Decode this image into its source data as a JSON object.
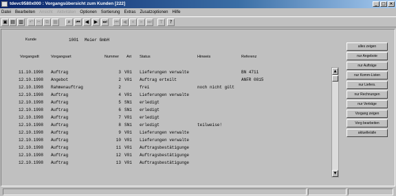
{
  "window": {
    "title": "tdevc9580x000 : Vorgangsübersicht zum Kunden [222]",
    "buttons": [
      "_",
      "□",
      "×"
    ]
  },
  "menu": [
    {
      "label": "Datei",
      "enabled": true
    },
    {
      "label": "Bearbeiten",
      "enabled": true
    },
    {
      "label": "Ansicht",
      "enabled": false
    },
    {
      "label": "Aktivitäten",
      "enabled": false
    },
    {
      "label": "Optionen",
      "enabled": true
    },
    {
      "label": "Sortierung",
      "enabled": true
    },
    {
      "label": "Extras",
      "enabled": true
    },
    {
      "label": "Zusatzoptionen",
      "enabled": true
    },
    {
      "label": "Hilfe",
      "enabled": true
    }
  ],
  "toolbar": [
    {
      "name": "new-icon",
      "glyph": "▣",
      "enabled": true
    },
    {
      "name": "save-icon",
      "glyph": "▤",
      "enabled": true
    },
    {
      "name": "print-icon",
      "glyph": "▥",
      "enabled": true
    },
    {
      "name": "undo-icon",
      "glyph": "↶",
      "enabled": false
    },
    {
      "name": "cut-icon",
      "glyph": "✂",
      "enabled": false
    },
    {
      "name": "copy-icon",
      "glyph": "⧉",
      "enabled": false
    },
    {
      "name": "paste-icon",
      "glyph": "▦",
      "enabled": false
    },
    {
      "name": "find-icon",
      "glyph": "⌕",
      "enabled": true
    },
    {
      "name": "first-record-icon",
      "glyph": "⏮",
      "enabled": true
    },
    {
      "name": "previous-record-icon",
      "glyph": "◀",
      "enabled": true
    },
    {
      "name": "next-record-icon",
      "glyph": "▶",
      "enabled": true
    },
    {
      "name": "last-record-icon",
      "glyph": "⏭",
      "enabled": true
    },
    {
      "name": "first-page-icon",
      "glyph": "⏮",
      "enabled": false
    },
    {
      "name": "previous-page-icon",
      "glyph": "◀",
      "enabled": false
    },
    {
      "name": "rewind-icon",
      "glyph": "«",
      "enabled": false
    },
    {
      "name": "forward-icon",
      "glyph": "»",
      "enabled": false
    },
    {
      "name": "last-page-icon",
      "glyph": "⏭",
      "enabled": false
    },
    {
      "name": "text-icon",
      "glyph": "T",
      "enabled": false
    },
    {
      "name": "help-pointer-icon",
      "glyph": "?",
      "enabled": true
    }
  ],
  "customer": {
    "label": "Kunde",
    "number": "1001",
    "name": "Meier GmbH"
  },
  "columns": {
    "date": "Vorgangsdt",
    "type": "Vorgangsart",
    "number": "Nummer",
    "art": "Art",
    "status": "Status",
    "note": "Hinweis",
    "reference": "Referenz"
  },
  "rows": [
    {
      "date": "11.10.1998",
      "type": "Auftrag",
      "number": "3",
      "art": "V01",
      "status": "Lieferungen verwalte",
      "note": "",
      "reference": "BN 4711"
    },
    {
      "date": "12.10.1998",
      "type": "Angebot",
      "number": "2",
      "art": "V01",
      "status": "Auftrag erteilt",
      "note": "",
      "reference": "ANFR 0815"
    },
    {
      "date": "12.10.1998",
      "type": "Rahmenauftrag",
      "number": "2",
      "art": "",
      "status": "frei",
      "note": "noch nicht gült",
      "reference": ""
    },
    {
      "date": "12.10.1998",
      "type": "Auftrag",
      "number": "4",
      "art": "V01",
      "status": "Lieferungen verwalte",
      "note": "",
      "reference": ""
    },
    {
      "date": "12.10.1998",
      "type": "Auftrag",
      "number": "5",
      "art": "SN1",
      "status": "erledigt",
      "note": "",
      "reference": ""
    },
    {
      "date": "12.10.1998",
      "type": "Auftrag",
      "number": "6",
      "art": "SN1",
      "status": "erledigt",
      "note": "",
      "reference": ""
    },
    {
      "date": "12.10.1998",
      "type": "Auftrag",
      "number": "7",
      "art": "V01",
      "status": "erledigt",
      "note": "",
      "reference": ""
    },
    {
      "date": "12.10.1998",
      "type": "Auftrag",
      "number": "8",
      "art": "SN1",
      "status": "erledigt",
      "note": "teilweise!",
      "reference": ""
    },
    {
      "date": "12.10.1998",
      "type": "Auftrag",
      "number": "9",
      "art": "V01",
      "status": "Lieferungen verwalte",
      "note": "",
      "reference": ""
    },
    {
      "date": "12.10.1998",
      "type": "Auftrag",
      "number": "10",
      "art": "V01",
      "status": "Lieferungen verwalte",
      "note": "",
      "reference": ""
    },
    {
      "date": "12.10.1998",
      "type": "Auftrag",
      "number": "11",
      "art": "V01",
      "status": "Auftragsbestätigunge",
      "note": "",
      "reference": ""
    },
    {
      "date": "12.10.1998",
      "type": "Auftrag",
      "number": "12",
      "art": "V01",
      "status": "Auftragsbestätigunge",
      "note": "",
      "reference": ""
    },
    {
      "date": "12.10.1998",
      "type": "Auftrag",
      "number": "13",
      "art": "V01",
      "status": "Auftragsbestätigunge",
      "note": "",
      "reference": ""
    }
  ],
  "scrollbar": {
    "up": "▲",
    "down": "▼"
  },
  "side_buttons": [
    "alles zeigen",
    "nur Angebote",
    "nur Aufträge",
    "nur Komm-Listen",
    "nur Liefers.",
    "nur Rechnungen",
    "nur Verträge",
    "Vorgang zeigen",
    "Vorg bearbeiten",
    "aktuelle/alle"
  ]
}
